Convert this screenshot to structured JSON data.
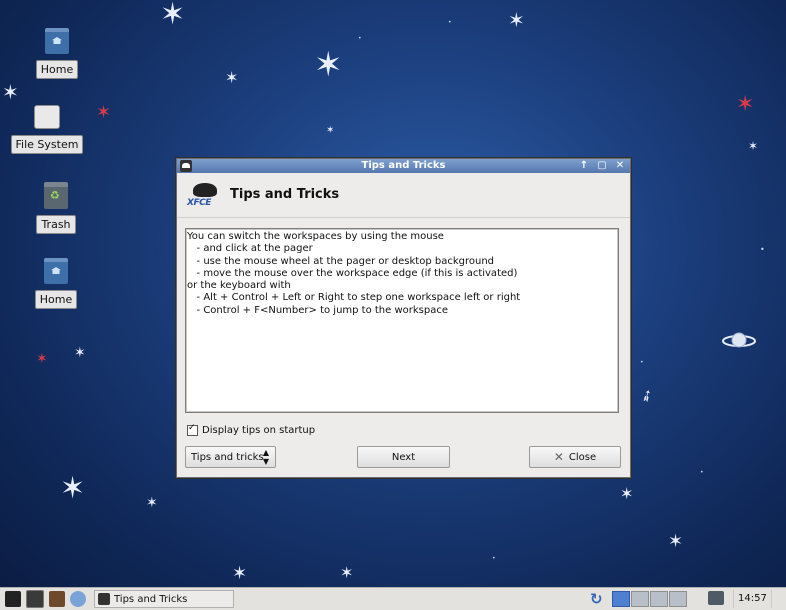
{
  "desktop": {
    "icons": [
      {
        "label": "Home",
        "icon": "home-folder-icon"
      },
      {
        "label": "File System",
        "icon": "drive-icon"
      },
      {
        "label": "Trash",
        "icon": "trash-icon"
      },
      {
        "label": "Home",
        "icon": "home-folder-icon"
      }
    ]
  },
  "dialog": {
    "window_title": "Tips and Tricks",
    "header_title": "Tips and Tricks",
    "logo_text": "XFCE",
    "window_buttons": [
      "↑",
      "▢",
      "✕"
    ],
    "tip_text": "You can switch the workspaces by using the mouse\n   - and click at the pager\n   - use the mouse wheel at the pager or desktop background\n   - move the mouse over the workspace edge (if this is activated)\nor the keyboard with\n   - Alt + Control + Left or Right to step one workspace left or right\n   - Control + F<Number> to jump to the workspace",
    "checkbox_label": "Display tips on startup",
    "checkbox_checked": true,
    "combo_value": "Tips and tricks",
    "next_label": "Next",
    "close_label": "Close"
  },
  "taskbar": {
    "task_label": "Tips and Tricks",
    "clock": "14:57",
    "workspaces": 4,
    "active_workspace": 1
  },
  "colors": {
    "desktop_bg": "#1c3f7e",
    "titlebar": "#6a8bc0",
    "accent_star_red": "#d93a4a"
  }
}
